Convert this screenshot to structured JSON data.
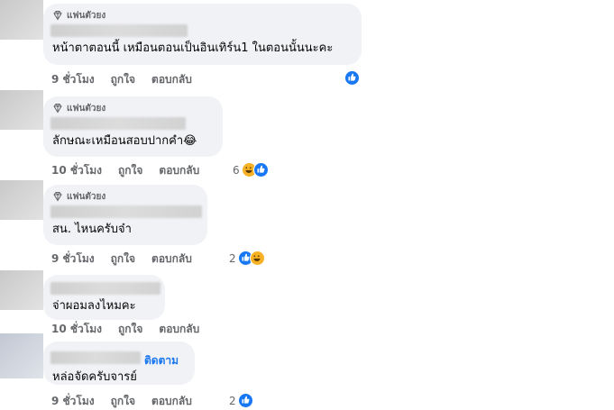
{
  "badge_label": "แฟนตัวยง",
  "actions": {
    "like": "ถูกใจ",
    "reply": "ตอบกลับ"
  },
  "follow_label": "ติดตาม",
  "colors": {
    "bubble": "#f0f2f5",
    "like": "#1877f2",
    "haha": "#f7b125",
    "meta": "#65676b"
  },
  "comments": [
    {
      "text": "หน้าตาตอนนี้ เหมือนตอนเป็นอินเทิร์น1 ในตอนนั้นนะคะ",
      "time": "9 ชั่วโมง",
      "reaction_count": "",
      "reactions": [
        "like"
      ]
    },
    {
      "text": "ลักษณะเหมือนสอบปากคำ😂",
      "time": "10 ชั่วโมง",
      "reaction_count": "6",
      "reactions": [
        "haha",
        "like"
      ]
    },
    {
      "text": "สน. ไหนครับจ๋า",
      "time": "9 ชั่วโมง",
      "reaction_count": "2",
      "reactions": [
        "like",
        "haha"
      ]
    },
    {
      "text": "จ่าผอมลงไหมคะ",
      "time": "10 ชั่วโมง",
      "reaction_count": "",
      "reactions": []
    },
    {
      "text": "หล่อจัดครับจารย์",
      "time": "9 ชั่วโมง",
      "reaction_count": "2",
      "reactions": [
        "like"
      ]
    }
  ]
}
